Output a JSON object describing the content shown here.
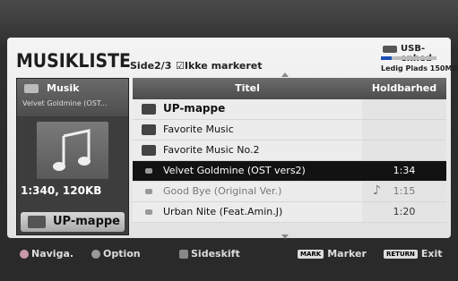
{
  "header": {
    "title": "MUSIKLISTE",
    "page_info": "Side2/3",
    "unmarked": "☑Ikke markeret"
  },
  "usb": {
    "label": "USB-enhed",
    "free_space": "Ledig Plads 150MB",
    "used_fraction": 0.2
  },
  "preview": {
    "title": "Musik",
    "subtitle": "Velvet Goldmine (OST...",
    "info": "1:340, 120KB",
    "button_label": "UP-mappe"
  },
  "list": {
    "col_title": "Titel",
    "col_duration": "Holdbarhed",
    "rows": [
      {
        "name": "UP-mappe",
        "duration": "",
        "type": "up"
      },
      {
        "name": "Favorite Music",
        "duration": "",
        "type": "folder"
      },
      {
        "name": "Favorite Music No.2",
        "duration": "",
        "type": "folder"
      },
      {
        "name": "Velvet Goldmine (OST vers2)",
        "duration": "1:34",
        "type": "file",
        "selected": true
      },
      {
        "name": "Good Bye (Original Ver.)",
        "duration": "1:15",
        "type": "file",
        "playing": true
      },
      {
        "name": "Urban Nite (Feat.Amin.J)",
        "duration": "1:20",
        "type": "file"
      }
    ]
  },
  "footer": {
    "navigate": "Naviga.",
    "option": "Option",
    "pageswitch": "Sideskift",
    "mark_key": "MARK",
    "mark": "Marker",
    "return_key": "RETURN",
    "exit": "Exit"
  }
}
